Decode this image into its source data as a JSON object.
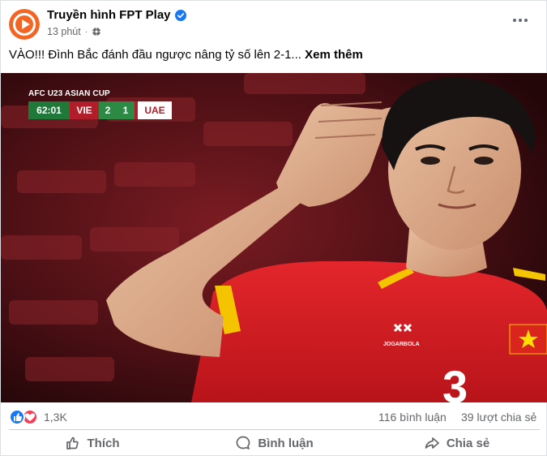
{
  "post": {
    "page_name": "Truyền hình FPT Play",
    "time": "13 phút",
    "caption": "VÀO!!! Đình Bắc đánh đầu ngược nâng tỷ số lên 2-1...",
    "see_more": "Xem thêm"
  },
  "scoreboard": {
    "competition": "AFC U23 ASIAN CUP",
    "clock": "62:01",
    "home": "VIE",
    "home_score": "2",
    "away_score": "1",
    "away": "UAE"
  },
  "jersey": {
    "brand": "JOGARBOLA",
    "number": "3"
  },
  "stats": {
    "reactions": "1,3K",
    "comments": "116 bình luận",
    "shares": "39 lượt chia sẻ"
  },
  "actions": {
    "like": "Thích",
    "comment": "Bình luận",
    "share": "Chia sẻ"
  },
  "icons": {
    "avatar": "fpt-play-logo",
    "verified": "verified-badge-icon",
    "audience": "public-globe-icon",
    "more": "more-options-icon",
    "like": "thumbs-up-icon",
    "comment": "comment-bubble-icon",
    "share": "share-arrow-icon"
  },
  "colors": {
    "accent": "#1877f2",
    "brand": "#f26522",
    "love": "#f33e58"
  }
}
